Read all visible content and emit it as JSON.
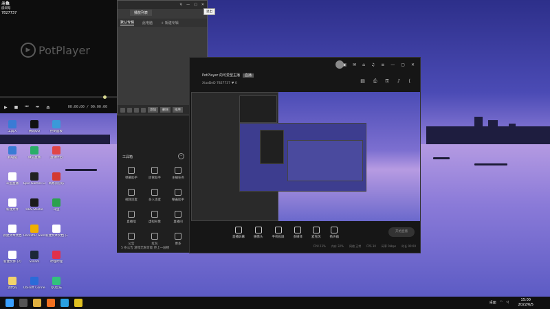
{
  "video": {
    "corner_line1": "斗鱼",
    "corner_line2": "房间号",
    "room_id": "7827737",
    "logo": "PotPlayer",
    "time": "00:00:00 / 00:00:00"
  },
  "playlist": {
    "title": "播放列表",
    "tabs": [
      "默认专辑",
      "此电脑",
      "+ 新建专辑"
    ],
    "foot_buttons": [
      "添加",
      "删除",
      "排序"
    ]
  },
  "close_tooltip": "退出",
  "tools": {
    "header": "工具箱",
    "items": [
      "弹幕助手",
      "房管助手",
      "主播任务",
      "视频连麦",
      "多人连麦",
      "整蛊助手",
      "直播墙",
      "虚拟形象",
      "直播间",
      "公告",
      "红包",
      "更多"
    ],
    "notice": "5 条公告  游戏无限可能  更上一层楼"
  },
  "main": {
    "room_title": "PotPlayer 的可爱型主播",
    "room_tag": "直播",
    "room_info": "XiaoDeD  7827737",
    "like_count": "0",
    "bottom": [
      "直播屏幕",
      "摄像头",
      "手机投屏",
      "多媒体",
      "麦克风",
      "扬声器"
    ],
    "start_label": "开始直播",
    "status": [
      "CPU 23%",
      "内存 32%",
      "网络 正常",
      "FPS 30",
      "码率 0kbps",
      "时长 00:00"
    ]
  },
  "desktop_icons": [
    {
      "label": "工具人",
      "color": "#3a7bd5"
    },
    {
      "label": "腾讯QQ",
      "color": "#111111"
    },
    {
      "label": "控制面板",
      "color": "#3a9ad9"
    },
    {
      "label": "此电脑",
      "color": "#3a7bd5"
    },
    {
      "label": "微信直播",
      "color": "#2aae67"
    },
    {
      "label": "直播伴侣",
      "color": "#e04646"
    },
    {
      "label": "斗鱼直播",
      "color": "#ffffff"
    },
    {
      "label": "Epic Games Launcher",
      "color": "#222222"
    },
    {
      "label": "网易云音乐",
      "color": "#d33a31"
    },
    {
      "label": "新建文件",
      "color": "#ffffff"
    },
    {
      "label": "OBS Studio",
      "color": "#1b1b1b"
    },
    {
      "label": "斗鱼",
      "color": "#2ba14e"
    },
    {
      "label": "新建文本文档",
      "color": "#ffffff"
    },
    {
      "label": "Rockstar Games",
      "color": "#f0b000"
    },
    {
      "label": "新建文本文档 (2)",
      "color": "#ffffff"
    },
    {
      "label": "新建文件 (2)",
      "color": "#ffffff"
    },
    {
      "label": "Steam",
      "color": "#1b2838"
    },
    {
      "label": "哔哩哔哩",
      "color": "#e0304a"
    },
    {
      "label": "源代码",
      "color": "#f2d36b"
    },
    {
      "label": "Ubisoft Connect",
      "color": "#2b6bd8"
    },
    {
      "label": "QQ音乐",
      "color": "#31c27c"
    }
  ],
  "taskbar": {
    "time": "15:00",
    "date": "2022/6/5",
    "tray_label": "桌面"
  }
}
